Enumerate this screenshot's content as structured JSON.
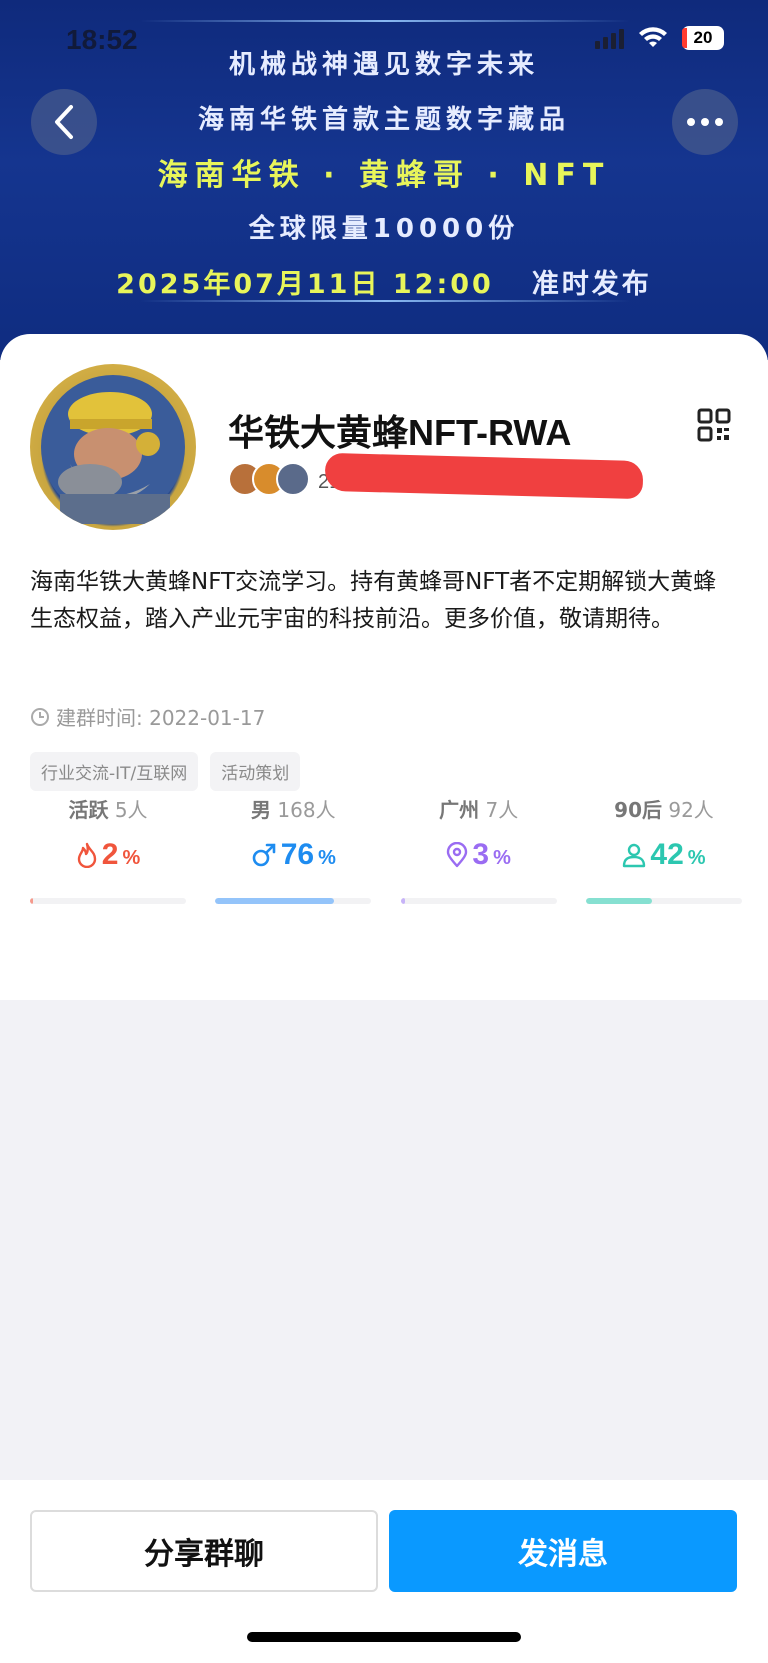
{
  "status_bar": {
    "time": "18:52",
    "battery": "20"
  },
  "banner": {
    "line1": "机械战神遇见数字未来",
    "line2": "海南华铁首款主题数字藏品",
    "line3": "海南华铁 · 黄蜂哥 · NFT",
    "line4": "全球限量10000份",
    "date": "2025年07月11日 12:00",
    "release": "准时发布"
  },
  "group": {
    "name": "华铁大黄蜂NFT-RWA",
    "members_text": "219人 · 群号",
    "description": "海南华铁大黄蜂NFT交流学习。持有黄蜂哥NFT者不定期解锁大黄蜂生态权益，踏入产业元宇宙的科技前沿。更多价值，敬请期待。",
    "founded": "建群时间: 2022-01-17",
    "tags": [
      "行业交流-IT/互联网",
      "活动策划"
    ]
  },
  "stats": [
    {
      "key": "活跃",
      "count": "5人",
      "value": "2",
      "unit": "%",
      "fraction": 0.02,
      "icon": "flame-icon",
      "color": "#f0553c"
    },
    {
      "key": "男",
      "count": "168人",
      "value": "76",
      "unit": "%",
      "fraction": 0.76,
      "icon": "male-icon",
      "color": "#1e8cf0"
    },
    {
      "key": "广州",
      "count": "7人",
      "value": "3",
      "unit": "%",
      "fraction": 0.03,
      "icon": "location-icon",
      "color": "#9a6cf2"
    },
    {
      "key": "90后",
      "count": "92人",
      "value": "42",
      "unit": "%",
      "fraction": 0.42,
      "icon": "person-icon",
      "color": "#2cc7b0"
    }
  ],
  "bar_colors": [
    "#f59a8c",
    "#94c4fa",
    "#c7b3f8",
    "#86e0d1"
  ],
  "buttons": {
    "share": "分享群聊",
    "message": "发消息"
  }
}
